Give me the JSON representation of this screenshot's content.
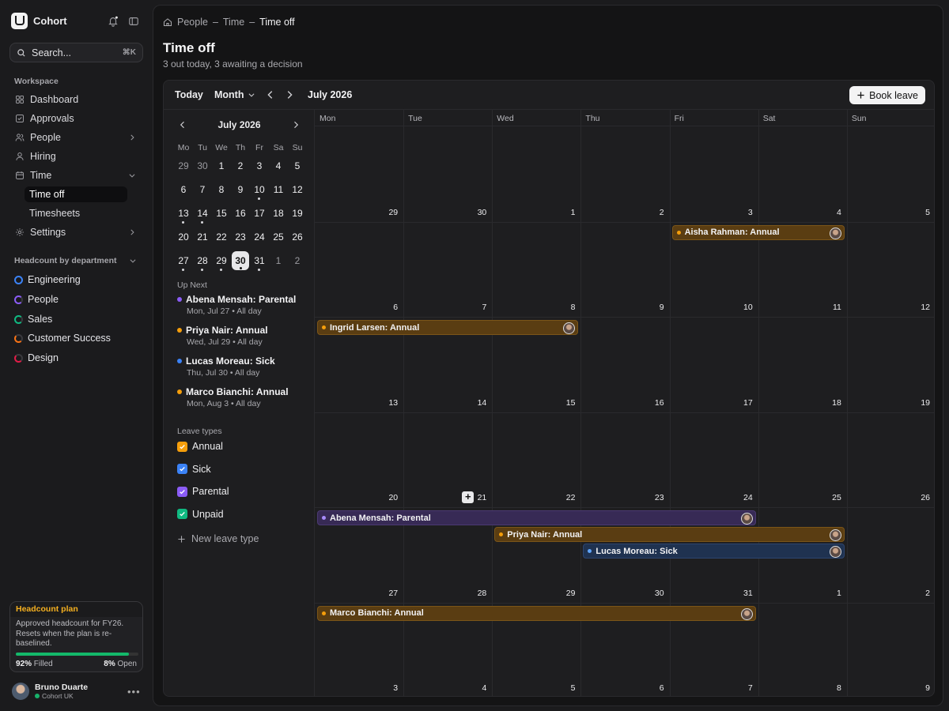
{
  "app": {
    "name": "Cohort"
  },
  "search": {
    "placeholder": "Search...",
    "shortcut": "⌘K"
  },
  "sidebar": {
    "workspace_label": "Workspace",
    "items": [
      {
        "label": "Dashboard",
        "icon": "grid-icon"
      },
      {
        "label": "Approvals",
        "icon": "check-square-icon"
      },
      {
        "label": "People",
        "icon": "users-icon"
      },
      {
        "label": "Hiring",
        "icon": "user-icon"
      },
      {
        "label": "Time",
        "icon": "calendar-icon"
      },
      {
        "label": "Settings",
        "icon": "gear-icon"
      }
    ],
    "time_sub": [
      "Time off",
      "Timesheets"
    ],
    "dept_label": "Headcount by department",
    "departments": [
      {
        "name": "Engineering",
        "color": "#3b82f6"
      },
      {
        "name": "People",
        "color": "#8b5cf6"
      },
      {
        "name": "Sales",
        "color": "#10b981"
      },
      {
        "name": "Customer Success",
        "color": "#f97316"
      },
      {
        "name": "Design",
        "color": "#e11d48"
      }
    ]
  },
  "plan": {
    "title": "Headcount plan",
    "desc": "Approved headcount for FY26. Resets when the plan is re-baselined.",
    "filled_pct": "92%",
    "filled_label": "Filled",
    "open_pct": "8%",
    "open_label": "Open",
    "fill_fraction": 0.92
  },
  "user": {
    "name": "Bruno Duarte",
    "org": "Cohort UK"
  },
  "breadcrumb": [
    "People",
    "Time",
    "Time off"
  ],
  "page": {
    "title": "Time off",
    "subtitle": "3 out today, 3 awaiting a decision"
  },
  "toolbar": {
    "today": "Today",
    "view": "Month",
    "label": "July 2026",
    "book": "Book leave"
  },
  "mini": {
    "title": "July 2026",
    "dow": [
      "Mo",
      "Tu",
      "We",
      "Th",
      "Fr",
      "Sa",
      "Su"
    ],
    "weeks": [
      [
        [
          "29",
          1,
          0
        ],
        [
          "30",
          1,
          0
        ],
        [
          "1",
          0,
          0
        ],
        [
          "2",
          0,
          0
        ],
        [
          "3",
          0,
          0
        ],
        [
          "4",
          0,
          0
        ],
        [
          "5",
          0,
          0
        ]
      ],
      [
        [
          "6",
          0,
          0
        ],
        [
          "7",
          0,
          0
        ],
        [
          "8",
          0,
          0
        ],
        [
          "9",
          0,
          0
        ],
        [
          "10",
          0,
          1
        ],
        [
          "11",
          0,
          0
        ],
        [
          "12",
          0,
          0
        ]
      ],
      [
        [
          "13",
          0,
          1
        ],
        [
          "14",
          0,
          1
        ],
        [
          "15",
          0,
          0
        ],
        [
          "16",
          0,
          0
        ],
        [
          "17",
          0,
          0
        ],
        [
          "18",
          0,
          0
        ],
        [
          "19",
          0,
          0
        ]
      ],
      [
        [
          "20",
          0,
          0
        ],
        [
          "21",
          0,
          0
        ],
        [
          "22",
          0,
          0
        ],
        [
          "23",
          0,
          0
        ],
        [
          "24",
          0,
          0
        ],
        [
          "25",
          0,
          0
        ],
        [
          "26",
          0,
          0
        ]
      ],
      [
        [
          "27",
          0,
          1
        ],
        [
          "28",
          0,
          1
        ],
        [
          "29",
          0,
          1
        ],
        [
          "30",
          0,
          1
        ],
        [
          "31",
          0,
          1
        ],
        [
          "1",
          1,
          0
        ],
        [
          "2",
          1,
          0
        ]
      ]
    ],
    "selected": "30"
  },
  "upnext": {
    "label": "Up Next",
    "items": [
      {
        "title": "Abena Mensah: Parental",
        "date": "Mon, Jul 27",
        "time": "All day",
        "color": "#8b5cf6"
      },
      {
        "title": "Priya Nair: Annual",
        "date": "Wed, Jul 29",
        "time": "All day",
        "color": "#f59e0b"
      },
      {
        "title": "Lucas Moreau: Sick",
        "date": "Thu, Jul 30",
        "time": "All day",
        "color": "#3b82f6"
      },
      {
        "title": "Marco Bianchi: Annual",
        "date": "Mon, Aug 3",
        "time": "All day",
        "color": "#f59e0b"
      }
    ]
  },
  "leave_types": {
    "label": "Leave types",
    "items": [
      {
        "name": "Annual",
        "color": "#f59e0b"
      },
      {
        "name": "Sick",
        "color": "#3b82f6"
      },
      {
        "name": "Parental",
        "color": "#8b5cf6"
      },
      {
        "name": "Unpaid",
        "color": "#10b981"
      }
    ],
    "new_label": "New leave type"
  },
  "calendar": {
    "dow": [
      "Mon",
      "Tue",
      "Wed",
      "Thu",
      "Fri",
      "Sat",
      "Sun"
    ],
    "weeks": [
      [
        "29",
        "30",
        "1",
        "2",
        "3",
        "4",
        "5"
      ],
      [
        "6",
        "7",
        "8",
        "9",
        "10",
        "11",
        "12"
      ],
      [
        "13",
        "14",
        "15",
        "16",
        "17",
        "18",
        "19"
      ],
      [
        "20",
        "21",
        "22",
        "23",
        "24",
        "25",
        "26"
      ],
      [
        "27",
        "28",
        "29",
        "30",
        "31",
        "1",
        "2"
      ],
      [
        "3",
        "4",
        "5",
        "6",
        "7",
        "8",
        "9"
      ]
    ],
    "events": [
      {
        "label": "Aisha Rahman: Annual",
        "week": 1,
        "start": 4,
        "end": 5,
        "lane": 0,
        "type": "annual"
      },
      {
        "label": "Ingrid Larsen: Annual",
        "week": 2,
        "start": 0,
        "end": 2,
        "lane": 0,
        "type": "annual"
      },
      {
        "label": "Abena Mensah: Parental",
        "week": 4,
        "start": 0,
        "end": 4,
        "lane": 0,
        "type": "parental"
      },
      {
        "label": "Priya Nair: Annual",
        "week": 4,
        "start": 2,
        "end": 5,
        "lane": 1,
        "type": "annual"
      },
      {
        "label": "Lucas Moreau: Sick",
        "week": 4,
        "start": 3,
        "end": 5,
        "lane": 2,
        "type": "sick"
      },
      {
        "label": "Marco Bianchi: Annual",
        "week": 5,
        "start": 0,
        "end": 4,
        "lane": 0,
        "type": "annual"
      }
    ],
    "type_colors": {
      "annual": {
        "bg": "#5a3d12",
        "border": "#7b5518",
        "dot": "#f59e0b"
      },
      "parental": {
        "bg": "#372a55",
        "border": "#4b3a72",
        "dot": "#a78bfa"
      },
      "sick": {
        "bg": "#1f3250",
        "border": "#2d4670",
        "dot": "#60a5fa"
      }
    }
  }
}
